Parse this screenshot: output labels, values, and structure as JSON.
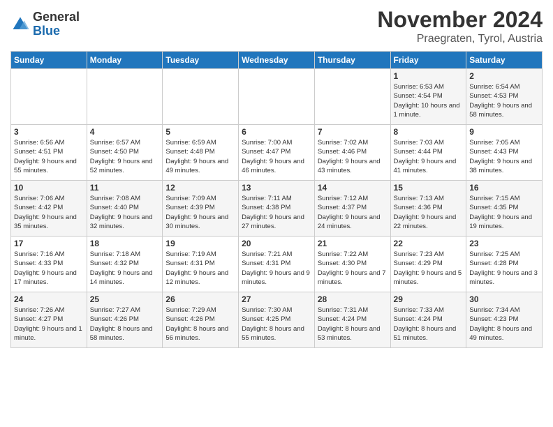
{
  "logo": {
    "line1": "General",
    "line2": "Blue"
  },
  "title": "November 2024",
  "location": "Praegraten, Tyrol, Austria",
  "weekdays": [
    "Sunday",
    "Monday",
    "Tuesday",
    "Wednesday",
    "Thursday",
    "Friday",
    "Saturday"
  ],
  "weeks": [
    [
      {
        "day": "",
        "info": ""
      },
      {
        "day": "",
        "info": ""
      },
      {
        "day": "",
        "info": ""
      },
      {
        "day": "",
        "info": ""
      },
      {
        "day": "",
        "info": ""
      },
      {
        "day": "1",
        "info": "Sunrise: 6:53 AM\nSunset: 4:54 PM\nDaylight: 10 hours and 1 minute."
      },
      {
        "day": "2",
        "info": "Sunrise: 6:54 AM\nSunset: 4:53 PM\nDaylight: 9 hours and 58 minutes."
      }
    ],
    [
      {
        "day": "3",
        "info": "Sunrise: 6:56 AM\nSunset: 4:51 PM\nDaylight: 9 hours and 55 minutes."
      },
      {
        "day": "4",
        "info": "Sunrise: 6:57 AM\nSunset: 4:50 PM\nDaylight: 9 hours and 52 minutes."
      },
      {
        "day": "5",
        "info": "Sunrise: 6:59 AM\nSunset: 4:48 PM\nDaylight: 9 hours and 49 minutes."
      },
      {
        "day": "6",
        "info": "Sunrise: 7:00 AM\nSunset: 4:47 PM\nDaylight: 9 hours and 46 minutes."
      },
      {
        "day": "7",
        "info": "Sunrise: 7:02 AM\nSunset: 4:46 PM\nDaylight: 9 hours and 43 minutes."
      },
      {
        "day": "8",
        "info": "Sunrise: 7:03 AM\nSunset: 4:44 PM\nDaylight: 9 hours and 41 minutes."
      },
      {
        "day": "9",
        "info": "Sunrise: 7:05 AM\nSunset: 4:43 PM\nDaylight: 9 hours and 38 minutes."
      }
    ],
    [
      {
        "day": "10",
        "info": "Sunrise: 7:06 AM\nSunset: 4:42 PM\nDaylight: 9 hours and 35 minutes."
      },
      {
        "day": "11",
        "info": "Sunrise: 7:08 AM\nSunset: 4:40 PM\nDaylight: 9 hours and 32 minutes."
      },
      {
        "day": "12",
        "info": "Sunrise: 7:09 AM\nSunset: 4:39 PM\nDaylight: 9 hours and 30 minutes."
      },
      {
        "day": "13",
        "info": "Sunrise: 7:11 AM\nSunset: 4:38 PM\nDaylight: 9 hours and 27 minutes."
      },
      {
        "day": "14",
        "info": "Sunrise: 7:12 AM\nSunset: 4:37 PM\nDaylight: 9 hours and 24 minutes."
      },
      {
        "day": "15",
        "info": "Sunrise: 7:13 AM\nSunset: 4:36 PM\nDaylight: 9 hours and 22 minutes."
      },
      {
        "day": "16",
        "info": "Sunrise: 7:15 AM\nSunset: 4:35 PM\nDaylight: 9 hours and 19 minutes."
      }
    ],
    [
      {
        "day": "17",
        "info": "Sunrise: 7:16 AM\nSunset: 4:33 PM\nDaylight: 9 hours and 17 minutes."
      },
      {
        "day": "18",
        "info": "Sunrise: 7:18 AM\nSunset: 4:32 PM\nDaylight: 9 hours and 14 minutes."
      },
      {
        "day": "19",
        "info": "Sunrise: 7:19 AM\nSunset: 4:31 PM\nDaylight: 9 hours and 12 minutes."
      },
      {
        "day": "20",
        "info": "Sunrise: 7:21 AM\nSunset: 4:31 PM\nDaylight: 9 hours and 9 minutes."
      },
      {
        "day": "21",
        "info": "Sunrise: 7:22 AM\nSunset: 4:30 PM\nDaylight: 9 hours and 7 minutes."
      },
      {
        "day": "22",
        "info": "Sunrise: 7:23 AM\nSunset: 4:29 PM\nDaylight: 9 hours and 5 minutes."
      },
      {
        "day": "23",
        "info": "Sunrise: 7:25 AM\nSunset: 4:28 PM\nDaylight: 9 hours and 3 minutes."
      }
    ],
    [
      {
        "day": "24",
        "info": "Sunrise: 7:26 AM\nSunset: 4:27 PM\nDaylight: 9 hours and 1 minute."
      },
      {
        "day": "25",
        "info": "Sunrise: 7:27 AM\nSunset: 4:26 PM\nDaylight: 8 hours and 58 minutes."
      },
      {
        "day": "26",
        "info": "Sunrise: 7:29 AM\nSunset: 4:26 PM\nDaylight: 8 hours and 56 minutes."
      },
      {
        "day": "27",
        "info": "Sunrise: 7:30 AM\nSunset: 4:25 PM\nDaylight: 8 hours and 55 minutes."
      },
      {
        "day": "28",
        "info": "Sunrise: 7:31 AM\nSunset: 4:24 PM\nDaylight: 8 hours and 53 minutes."
      },
      {
        "day": "29",
        "info": "Sunrise: 7:33 AM\nSunset: 4:24 PM\nDaylight: 8 hours and 51 minutes."
      },
      {
        "day": "30",
        "info": "Sunrise: 7:34 AM\nSunset: 4:23 PM\nDaylight: 8 hours and 49 minutes."
      }
    ]
  ]
}
